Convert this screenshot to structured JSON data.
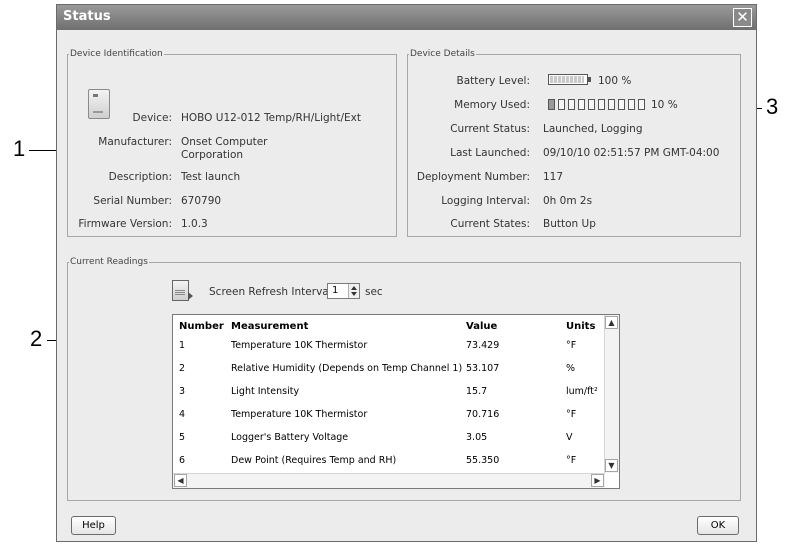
{
  "window": {
    "title": "Status"
  },
  "device_identification": {
    "legend": "Device Identification",
    "fields": [
      {
        "label": "Device:",
        "value": "HOBO U12-012 Temp/RH/Light/Ext"
      },
      {
        "label": "Manufacturer:",
        "value": "Onset Computer\nCorporation"
      },
      {
        "label": "Description:",
        "value": "Test launch"
      },
      {
        "label": "Serial Number:",
        "value": "670790"
      },
      {
        "label": "Firmware Version:",
        "value": "1.0.3"
      }
    ]
  },
  "device_details": {
    "legend": "Device Details",
    "battery": {
      "label": "Battery Level:",
      "value": "100 %",
      "level": 1.0
    },
    "memory": {
      "label": "Memory Used:",
      "value": "10 %",
      "segments": 10,
      "filled": 1
    },
    "fields": [
      {
        "label": "Current Status:",
        "value": "Launched, Logging"
      },
      {
        "label": "Last Launched:",
        "value": "09/10/10 02:51:57 PM GMT-04:00"
      },
      {
        "label": "Deployment Number:",
        "value": "117"
      },
      {
        "label": "Logging Interval:",
        "value": "0h 0m 2s"
      },
      {
        "label": "Current States:",
        "value": "Button Up"
      }
    ]
  },
  "current_readings": {
    "legend": "Current Readings",
    "refresh_label": "Screen Refresh Interval:",
    "refresh_value": "1",
    "refresh_unit": "sec",
    "columns": [
      "Number",
      "Measurement",
      "Value",
      "Units"
    ],
    "rows": [
      {
        "number": "1",
        "measurement": "Temperature 10K Thermistor",
        "value": "73.429",
        "units": "°F"
      },
      {
        "number": "2",
        "measurement": "Relative Humidity (Depends on Temp Channel 1)",
        "value": "53.107",
        "units": "%"
      },
      {
        "number": "3",
        "measurement": "Light Intensity",
        "value": "15.7",
        "units": "lum/ft²"
      },
      {
        "number": "4",
        "measurement": "Temperature 10K Thermistor",
        "value": "70.716",
        "units": "°F"
      },
      {
        "number": "5",
        "measurement": "Logger's Battery Voltage",
        "value": "3.05",
        "units": "V"
      },
      {
        "number": "6",
        "measurement": "Dew Point (Requires Temp and RH)",
        "value": "55.350",
        "units": "°F"
      }
    ]
  },
  "buttons": {
    "help": "Help",
    "ok": "OK"
  },
  "callouts": [
    "1",
    "2",
    "3"
  ]
}
